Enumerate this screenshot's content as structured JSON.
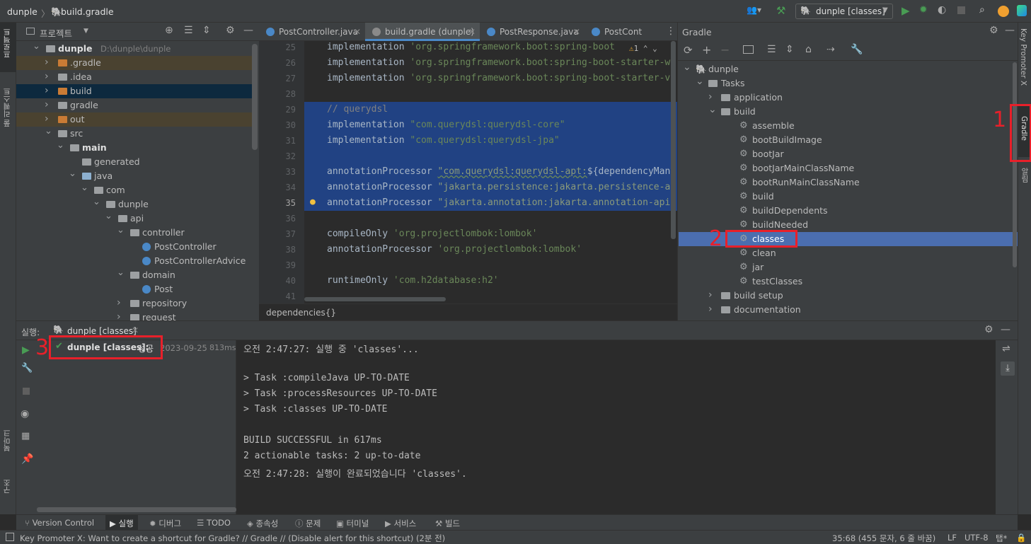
{
  "titlebar": {
    "project": "dunple",
    "file": "build.gradle",
    "run_config": "dunple [classes]"
  },
  "left_strip": {
    "project_label": "프로젝트",
    "commit_label": "풀 리퀘스트",
    "bookmarks_label": "북마크",
    "structure_label": "구조"
  },
  "project_panel": {
    "title": "프로젝트",
    "tree": [
      {
        "label": "dunple",
        "extra": "D:\\dunple\\dunple",
        "bold": true
      },
      {
        "label": ".gradle"
      },
      {
        "label": ".idea"
      },
      {
        "label": "build"
      },
      {
        "label": "gradle"
      },
      {
        "label": "out"
      },
      {
        "label": "src"
      },
      {
        "label": "main",
        "bold": true
      },
      {
        "label": "generated"
      },
      {
        "label": "java"
      },
      {
        "label": "com"
      },
      {
        "label": "dunple"
      },
      {
        "label": "api"
      },
      {
        "label": "controller"
      },
      {
        "label": "PostController"
      },
      {
        "label": "PostControllerAdvice"
      },
      {
        "label": "domain"
      },
      {
        "label": "Post"
      },
      {
        "label": "repository"
      },
      {
        "label": "request"
      }
    ]
  },
  "editor": {
    "tabs": [
      {
        "label": "PostController.java"
      },
      {
        "label": "build.gradle (dunple)",
        "active": true
      },
      {
        "label": "PostResponse.java"
      },
      {
        "label": "PostCont"
      }
    ],
    "warning": "1",
    "lines": [
      {
        "n": "25",
        "pre": "implementation ",
        "str": "'org.springframework.boot:spring-boot"
      },
      {
        "n": "26",
        "pre": "implementation ",
        "str": "'org.springframework.boot:spring-boot-starter-w"
      },
      {
        "n": "27",
        "pre": "implementation ",
        "str": "'org.springframework.boot:spring-boot-starter-v"
      },
      {
        "n": "28",
        "pre": "",
        "str": ""
      },
      {
        "n": "29",
        "cmt": "// querydsl"
      },
      {
        "n": "30",
        "pre": "implementation ",
        "str": "\"com.querydsl:querydsl-core\""
      },
      {
        "n": "31",
        "pre": "implementation ",
        "str": "\"com.querydsl:querydsl-jpa\""
      },
      {
        "n": "32",
        "pre": "",
        "str": ""
      },
      {
        "n": "33",
        "pre": "annotationProcessor ",
        "str": "\"com.querydsl:querydsl-apt:",
        "post": "${dependencyMan"
      },
      {
        "n": "34",
        "pre": "annotationProcessor ",
        "str": "\"jakarta.persistence:jakarta.persistence-a"
      },
      {
        "n": "35",
        "pre": "annotationProcessor ",
        "str": "\"jakarta.annotation:jakarta.annotation-api"
      },
      {
        "n": "36",
        "pre": "",
        "str": ""
      },
      {
        "n": "37",
        "pre": "compileOnly ",
        "str": "'org.projectlombok:lombok'"
      },
      {
        "n": "38",
        "pre": "annotationProcessor ",
        "str": "'org.projectlombok:lombok'"
      },
      {
        "n": "39",
        "pre": "",
        "str": ""
      },
      {
        "n": "40",
        "pre": "runtimeOnly ",
        "str": "'com.h2database:h2'"
      },
      {
        "n": "41",
        "pre": "",
        "str": ""
      }
    ],
    "breadcrumb": "dependencies{}"
  },
  "gradle_panel": {
    "title": "Gradle",
    "tree": [
      {
        "label": "dunple",
        "level": 0
      },
      {
        "label": "Tasks",
        "level": 1
      },
      {
        "label": "application",
        "level": 2
      },
      {
        "label": "build",
        "level": 2
      },
      {
        "label": "assemble",
        "level": 3
      },
      {
        "label": "bootBuildImage",
        "level": 3
      },
      {
        "label": "bootJar",
        "level": 3
      },
      {
        "label": "bootJarMainClassName",
        "level": 3
      },
      {
        "label": "bootRunMainClassName",
        "level": 3
      },
      {
        "label": "build",
        "level": 3
      },
      {
        "label": "buildDependents",
        "level": 3
      },
      {
        "label": "buildNeeded",
        "level": 3
      },
      {
        "label": "classes",
        "level": 3
      },
      {
        "label": "clean",
        "level": 3
      },
      {
        "label": "jar",
        "level": 3
      },
      {
        "label": "testClasses",
        "level": 3
      },
      {
        "label": "build setup",
        "level": 2
      },
      {
        "label": "documentation",
        "level": 2
      }
    ]
  },
  "right_strip": {
    "promoter": "Key Promoter X",
    "gradle": "Gradle",
    "notifications": "알림"
  },
  "run_panel": {
    "label": "실행:",
    "tab": "dunple [classes]",
    "result_name": "dunple [classes]:",
    "result_status": "성공",
    "result_date": "2023-09-25",
    "result_time": "813ms",
    "console": [
      "오전 2:47:27: 실행 중 'classes'...",
      "",
      "> Task :compileJava UP-TO-DATE",
      "> Task :processResources UP-TO-DATE",
      "> Task :classes UP-TO-DATE",
      "",
      "BUILD SUCCESSFUL in 617ms",
      "2 actionable tasks: 2 up-to-date",
      "오전 2:47:28: 실행이 완료되었습니다 'classes'."
    ]
  },
  "toolwindows": [
    "Version Control",
    "실행",
    "디버그",
    "TODO",
    "종속성",
    "문제",
    "터미널",
    "서비스",
    "빌드"
  ],
  "status": {
    "message": "Key Promoter X: Want to create a shortcut for Gradle? // Gradle // (Disable alert for this shortcut) (2분 전)",
    "position": "35:68 (455 문자, 6 줄 바꿈)",
    "line_sep": "LF",
    "encoding": "UTF-8",
    "indent": "탭*"
  },
  "annotations": [
    "1",
    "2",
    "3"
  ],
  "colors": {
    "accent": "#4a88c7",
    "selection": "#4b6eaf",
    "annotation": "#e8202a",
    "success": "#499c54"
  }
}
